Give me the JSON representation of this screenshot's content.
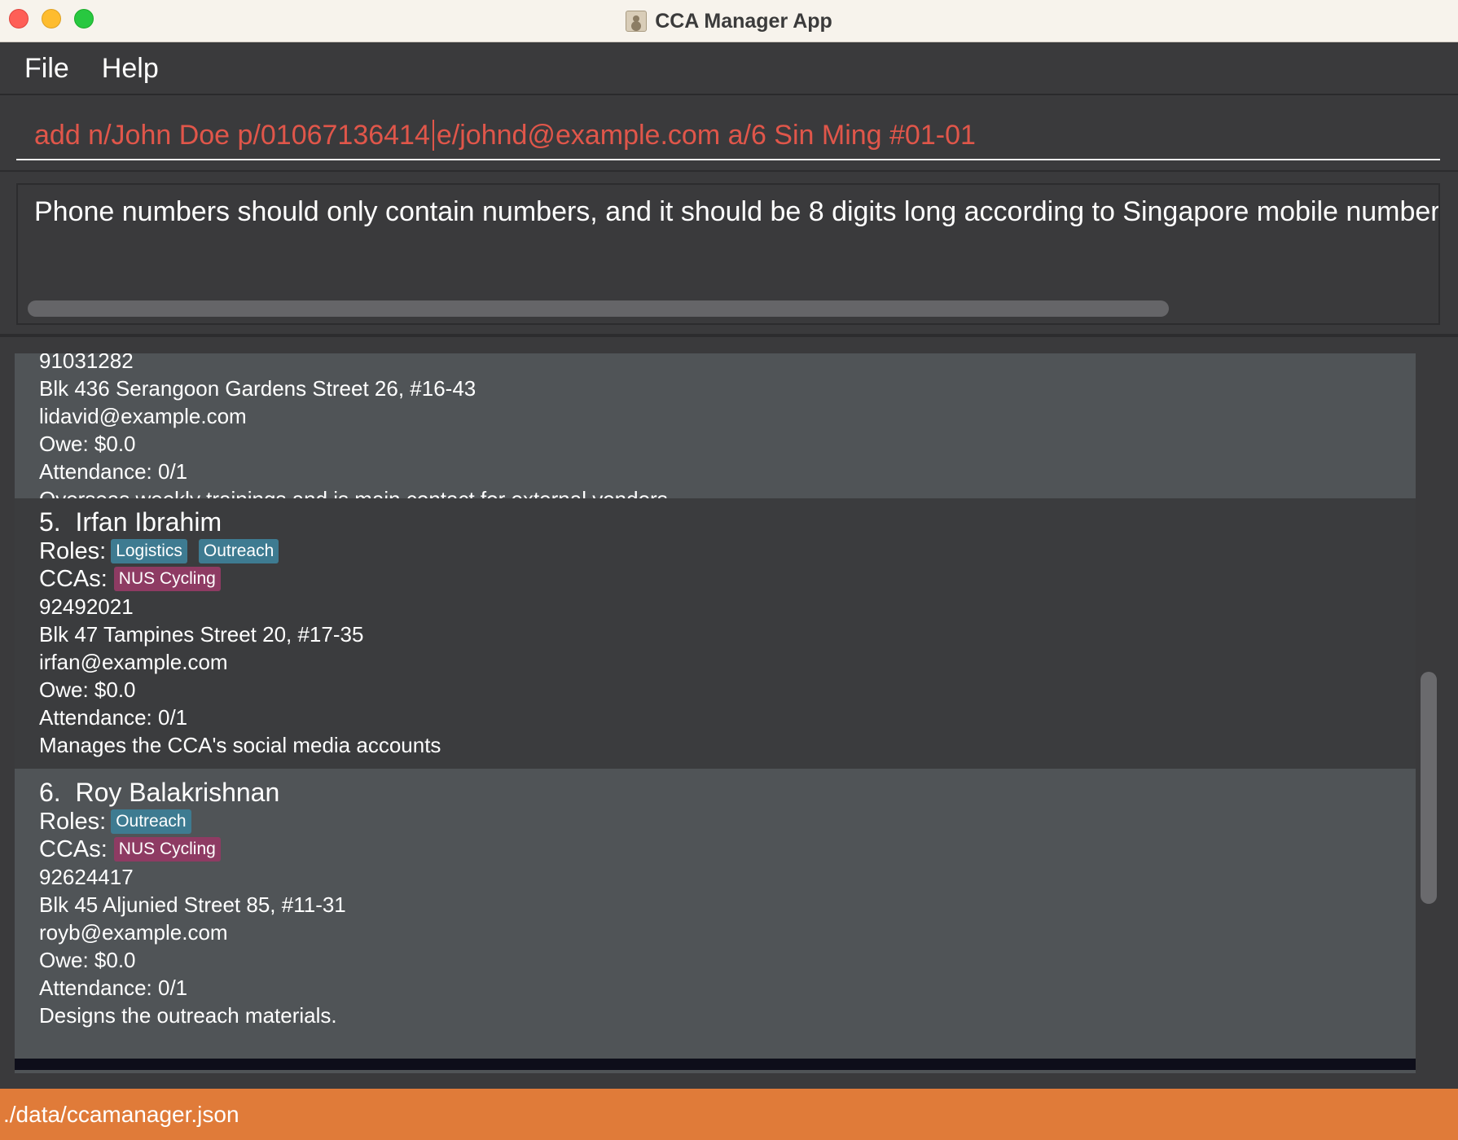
{
  "window": {
    "title": "CCA Manager App"
  },
  "menu": {
    "items": [
      "File",
      "Help"
    ]
  },
  "command": {
    "before_caret": "add n/John Doe p/01067136414",
    "after_caret": "e/johnd@example.com a/6 Sin Ming #01-01"
  },
  "result": {
    "message": "Phone numbers should only contain numbers, and it should be 8 digits long according to Singapore mobile number forma"
  },
  "persons": [
    {
      "phone": "91031282",
      "address": "Blk 436 Serangoon Gardens Street 26, #16-43",
      "email": "lidavid@example.com",
      "owe": "Owe: $0.0",
      "attendance": "Attendance: 0/1",
      "notes": "Overseas weekly trainings and is main contact for external vendors."
    },
    {
      "index": "5.",
      "name": "Irfan Ibrahim",
      "roles_label": "Roles:",
      "roles": [
        "Logistics",
        "Outreach"
      ],
      "ccas_label": "CCAs:",
      "ccas": [
        "NUS Cycling"
      ],
      "phone": "92492021",
      "address": "Blk 47 Tampines Street 20, #17-35",
      "email": "irfan@example.com",
      "owe": "Owe: $0.0",
      "attendance": "Attendance: 0/1",
      "notes": "Manages the CCA's social media accounts"
    },
    {
      "index": "6.",
      "name": "Roy Balakrishnan",
      "roles_label": "Roles:",
      "roles": [
        "Outreach"
      ],
      "ccas_label": "CCAs:",
      "ccas": [
        "NUS Cycling"
      ],
      "phone": "92624417",
      "address": "Blk 45 Aljunied Street 85, #11-31",
      "email": "royb@example.com",
      "owe": "Owe: $0.0",
      "attendance": "Attendance: 0/1",
      "notes": "Designs the outreach materials."
    }
  ],
  "status": {
    "file_path": "./data/ccamanager.json"
  },
  "colors": {
    "status_bar": "#e07b39",
    "role_tag": "#3e7b91",
    "cca_tag": "#8e3b63",
    "command_text": "#e0564a"
  }
}
